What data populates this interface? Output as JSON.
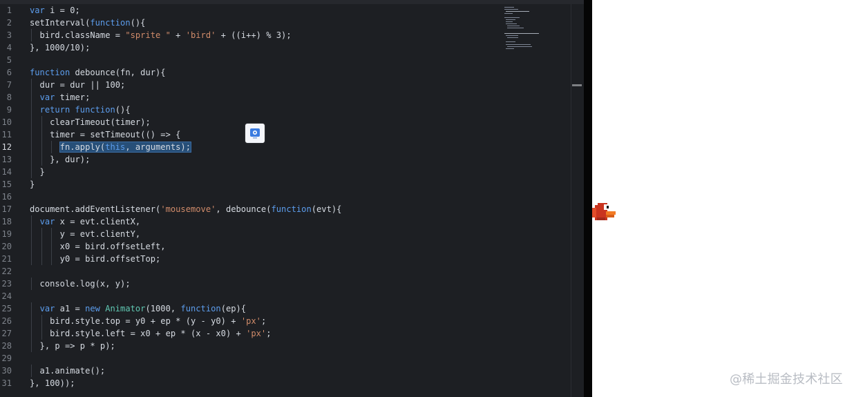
{
  "editor": {
    "code_lines": [
      {
        "num": "1",
        "text": "var i = 0;"
      },
      {
        "num": "2",
        "text": "setInterval(function(){"
      },
      {
        "num": "3",
        "text": "  bird.className = \"sprite \" + 'bird' + ((i++) % 3);"
      },
      {
        "num": "4",
        "text": "}, 1000/10);"
      },
      {
        "num": "5",
        "text": ""
      },
      {
        "num": "6",
        "text": "function debounce(fn, dur){"
      },
      {
        "num": "7",
        "text": "  dur = dur || 100;"
      },
      {
        "num": "8",
        "text": "  var timer;"
      },
      {
        "num": "9",
        "text": "  return function(){"
      },
      {
        "num": "10",
        "text": "    clearTimeout(timer);"
      },
      {
        "num": "11",
        "text": "    timer = setTimeout(() => {"
      },
      {
        "num": "12",
        "text": "      fn.apply(this, arguments);"
      },
      {
        "num": "13",
        "text": "    }, dur);"
      },
      {
        "num": "14",
        "text": "  }"
      },
      {
        "num": "15",
        "text": "}"
      },
      {
        "num": "16",
        "text": ""
      },
      {
        "num": "17",
        "text": "document.addEventListener('mousemove', debounce(function(evt){"
      },
      {
        "num": "18",
        "text": "  var x = evt.clientX,"
      },
      {
        "num": "19",
        "text": "      y = evt.clientY,"
      },
      {
        "num": "20",
        "text": "      x0 = bird.offsetLeft,"
      },
      {
        "num": "21",
        "text": "      y0 = bird.offsetTop;"
      },
      {
        "num": "22",
        "text": ""
      },
      {
        "num": "23",
        "text": "  console.log(x, y);"
      },
      {
        "num": "24",
        "text": ""
      },
      {
        "num": "25",
        "text": "  var a1 = new Animator(1000, function(ep){"
      },
      {
        "num": "26",
        "text": "    bird.style.top = y0 + ep * (y - y0) + 'px';"
      },
      {
        "num": "27",
        "text": "    bird.style.left = x0 + ep * (x - x0) + 'px';"
      },
      {
        "num": "28",
        "text": "  }, p => p * p);"
      },
      {
        "num": "29",
        "text": ""
      },
      {
        "num": "30",
        "text": "  a1.animate();"
      },
      {
        "num": "31",
        "text": "}, 100));"
      }
    ],
    "active_line": "12"
  },
  "colors": {
    "editor_bg": "#1d1f23",
    "keyword": "#5c9ded",
    "string": "#d08b6a",
    "class": "#60c7b2",
    "selection": "#274f78"
  },
  "icons": {
    "floating": "browser-extension-icon",
    "bird": "flappy-bird-sprite"
  },
  "watermark": {
    "text": "@稀土掘金技术社区"
  }
}
